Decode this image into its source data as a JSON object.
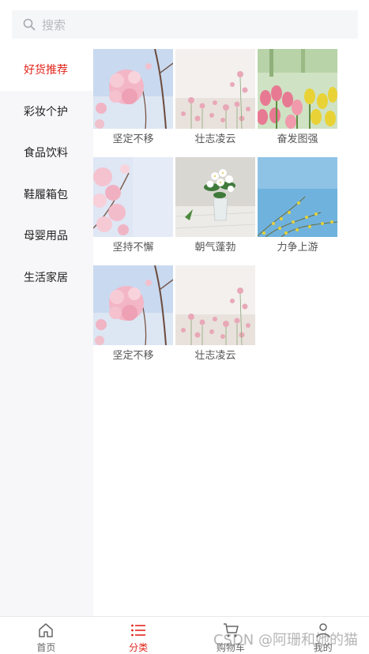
{
  "search": {
    "placeholder": "搜索"
  },
  "sidebar": {
    "items": [
      {
        "label": "好货推荐",
        "active": true
      },
      {
        "label": "彩妆个护",
        "active": false
      },
      {
        "label": "食品饮料",
        "active": false
      },
      {
        "label": "鞋履箱包",
        "active": false
      },
      {
        "label": "母婴用品",
        "active": false
      },
      {
        "label": "生活家居",
        "active": false
      }
    ]
  },
  "products": [
    {
      "name": "坚定不移",
      "image": "pink-cherry-blossom"
    },
    {
      "name": "壮志凌云",
      "image": "pink-cosmos-field"
    },
    {
      "name": "奋发图强",
      "image": "tulip-field"
    },
    {
      "name": "坚持不懈",
      "image": "cherry-blossom-sky"
    },
    {
      "name": "朝气蓬勃",
      "image": "white-flowers-vase"
    },
    {
      "name": "力争上游",
      "image": "yellow-forsythia-blue-sky"
    },
    {
      "name": "坚定不移",
      "image": "pink-cherry-blossom"
    },
    {
      "name": "壮志凌云",
      "image": "pink-cosmos-field"
    }
  ],
  "tabbar": {
    "tabs": [
      {
        "label": "首页",
        "icon": "home-icon",
        "active": false
      },
      {
        "label": "分类",
        "icon": "list-icon",
        "active": true
      },
      {
        "label": "购物车",
        "icon": "cart-icon",
        "active": false
      },
      {
        "label": "我的",
        "icon": "user-icon",
        "active": false
      }
    ]
  },
  "watermark": "CSDN @阿珊和她的猫",
  "colors": {
    "accent": "#e1251b",
    "sidebar_bg": "#f7f7f9",
    "search_bg": "#f5f6f8"
  }
}
